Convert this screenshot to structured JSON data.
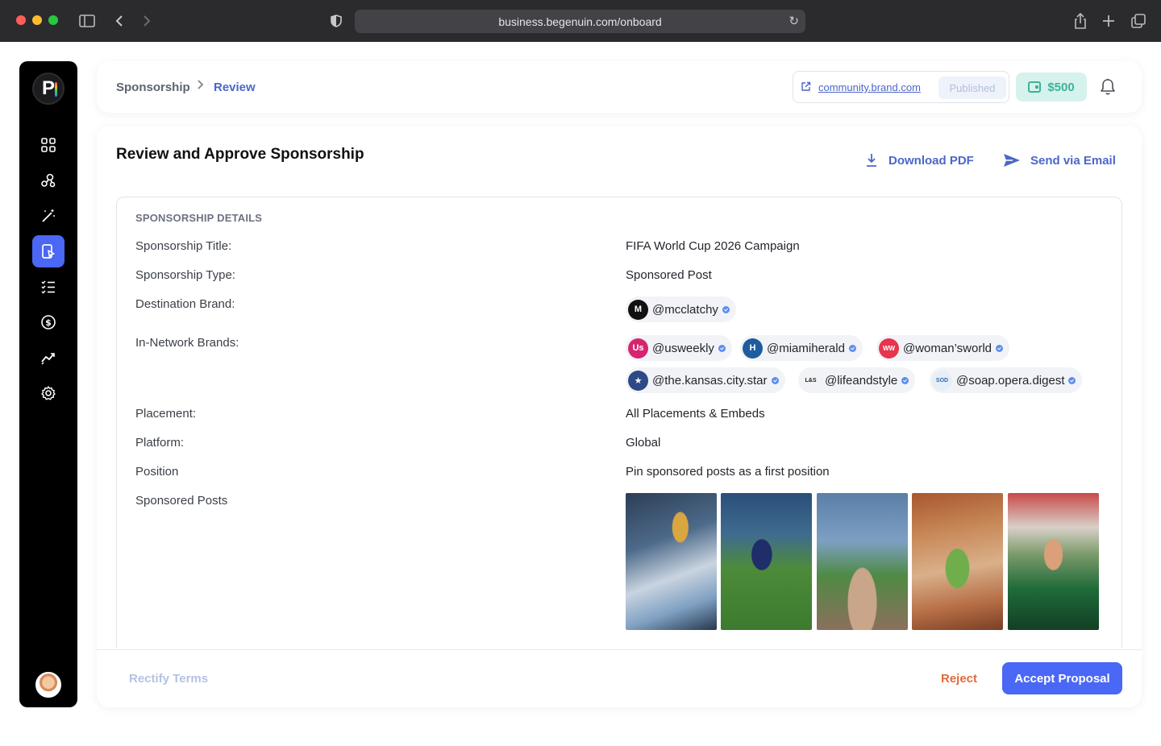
{
  "browser": {
    "url": "business.begenuin.com/onboard"
  },
  "sidebar": {
    "logo_letter": "P",
    "items": [
      {
        "icon": "grid-icon",
        "active": false
      },
      {
        "icon": "network-icon",
        "active": false
      },
      {
        "icon": "magic-wand-icon",
        "active": false
      },
      {
        "icon": "sponsorship-icon",
        "active": true
      },
      {
        "icon": "checklist-icon",
        "active": false
      },
      {
        "icon": "dollar-icon",
        "active": false
      },
      {
        "icon": "analytics-icon",
        "active": false
      },
      {
        "icon": "gear-icon",
        "active": false
      }
    ]
  },
  "header": {
    "breadcrumb": [
      "Sponsorship",
      "Review"
    ],
    "community_link": "community.brand.com",
    "status": "Published",
    "balance": "$500"
  },
  "main": {
    "title": "Review and Approve Sponsorship",
    "download_label": "Download PDF",
    "email_label": "Send via Email",
    "section_title": "SPONSORSHIP DETAILS",
    "fields": {
      "title_label": "Sponsorship Title:",
      "title_value": "FIFA World Cup 2026 Campaign",
      "type_label": "Sponsorship Type:",
      "type_value": "Sponsored Post",
      "destination_label": "Destination Brand:",
      "innetwork_label": "In-Network Brands:",
      "placement_label": "Placement:",
      "placement_value": "All Placements & Embeds",
      "platform_label": "Platform:",
      "platform_value": "Global",
      "position_label": "Position",
      "position_value": "Pin sponsored posts as a first position",
      "posts_label": "Sponsored Posts"
    },
    "destination_brand": {
      "handle": "@mcclatchy",
      "logo_text": "M",
      "color": "#111111"
    },
    "in_network_brands": [
      {
        "handle": "@usweekly",
        "logo_text": "Us",
        "color": "#d6246e"
      },
      {
        "handle": "@miamiherald",
        "logo_text": "H",
        "color": "#1d5c9e"
      },
      {
        "handle": "@woman’sworld",
        "logo_text": "WW",
        "color": "#e8344d"
      },
      {
        "handle": "@the.kansas.city.star",
        "logo_text": "★",
        "color": "#2d4a86"
      },
      {
        "handle": "@lifeandstyle",
        "logo_text": "L&S",
        "color": "#f2f3f6"
      },
      {
        "handle": "@soap.opera.digest",
        "logo_text": "SOD",
        "color": "#e6eef7"
      }
    ],
    "sponsored_posts": [
      {
        "name": "post-1"
      },
      {
        "name": "post-2"
      },
      {
        "name": "post-3"
      },
      {
        "name": "post-4"
      },
      {
        "name": "post-5"
      }
    ]
  },
  "footer": {
    "rectify_label": "Rectify Terms",
    "reject_label": "Reject",
    "accept_label": "Accept Proposal"
  }
}
